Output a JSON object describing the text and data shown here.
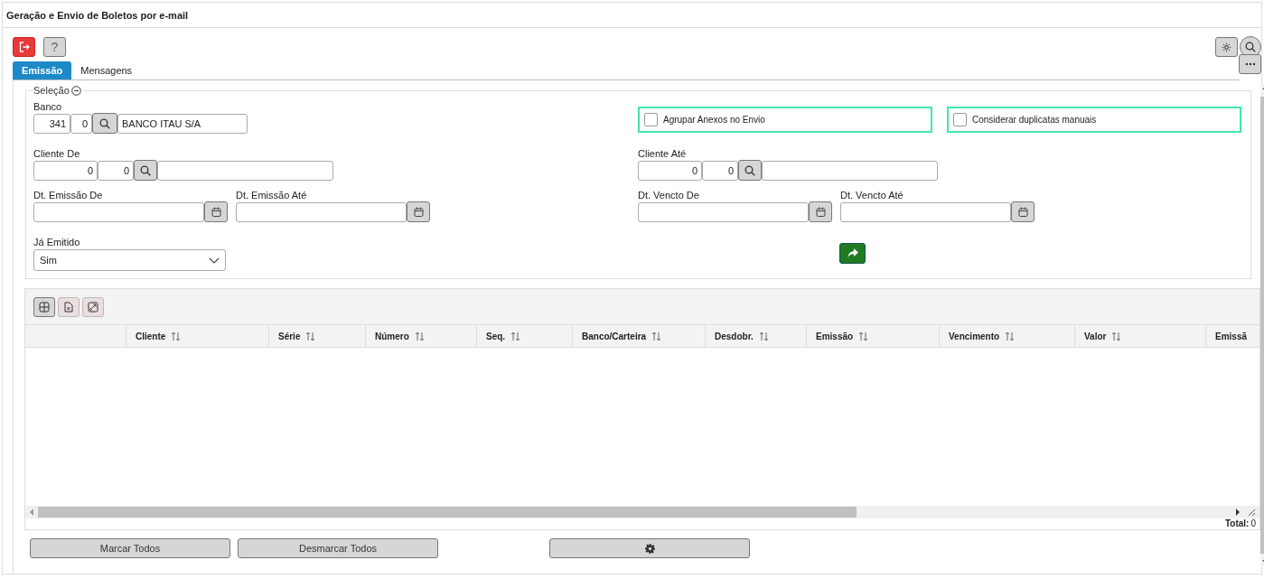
{
  "window": {
    "title": "Geração e Envio de Boletos por e-mail"
  },
  "help_button": "?",
  "tabs": [
    {
      "label": "Emissão",
      "selected": true
    },
    {
      "label": "Mensagens",
      "selected": false
    }
  ],
  "selection": {
    "legend": "Seleção",
    "expanded": true,
    "banco": {
      "label": "Banco",
      "code": "341",
      "sub": "0",
      "name": "BANCO ITAU S/A"
    },
    "options": [
      {
        "label": "Agrupar Anexos no Envio",
        "checked": false
      },
      {
        "label": "Considerar duplicatas manuais",
        "checked": false
      }
    ],
    "cliente_de": {
      "label": "Cliente De",
      "code": "0",
      "sub": "0"
    },
    "cliente_ate": {
      "label": "Cliente Até",
      "code": "0",
      "sub": "0"
    },
    "dates": [
      {
        "label": "Dt. Emissão De"
      },
      {
        "label": "Dt. Emissão Até"
      },
      {
        "label": "Dt. Vencto De"
      },
      {
        "label": "Dt. Vencto Até"
      }
    ],
    "ja_emitido": {
      "label": "Já Emitido",
      "value": "Sim"
    }
  },
  "grid": {
    "columns": [
      {
        "sortable": false
      },
      {
        "label": "Cliente",
        "sortable": true
      },
      {
        "label": "Série",
        "sortable": true
      },
      {
        "label": "Número",
        "sortable": true
      },
      {
        "label": "Seq.",
        "sortable": true
      },
      {
        "label": "Banco/Carteira",
        "sortable": true
      },
      {
        "label": "Desdobr.",
        "sortable": true
      },
      {
        "label": "Emissão",
        "sortable": true
      },
      {
        "label": "Vencimento",
        "sortable": true
      },
      {
        "label": "Valor",
        "sortable": true
      },
      {
        "label": "Emissã",
        "sortable": false
      }
    ],
    "total_label": "Total:",
    "total_value": "0"
  },
  "buttons": [
    {
      "kind": "text",
      "label": "Marcar Todos"
    },
    {
      "kind": "text",
      "label": "Desmarcar Todos"
    },
    {
      "kind": "gear"
    }
  ]
}
